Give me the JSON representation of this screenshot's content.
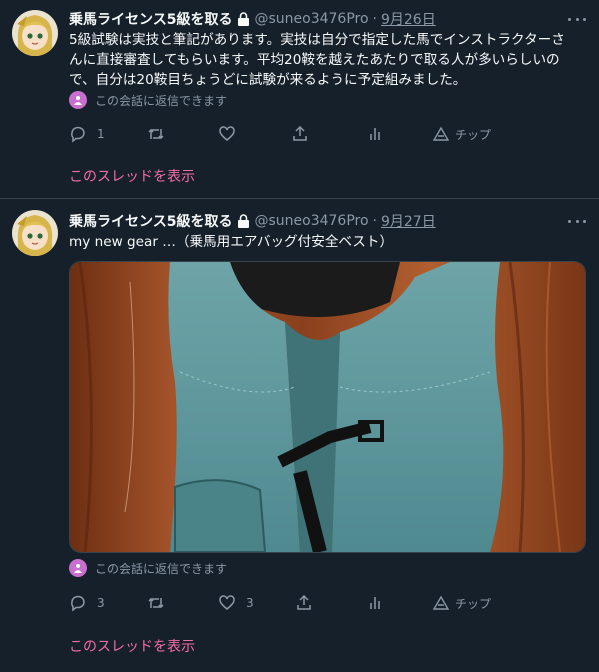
{
  "tweets": [
    {
      "display_name": "乗馬ライセンス5級を取る",
      "handle": "@suneo3476Pro",
      "separator": "·",
      "date": "9月26日",
      "text_lines": [
        "5級試験は実技と筆記があります。実技は自分で指定した馬でインストラクターさ",
        "んに直接審査してもらいます。平均20鞍を越えたあたりで取る人が多いらしいの",
        "で、自分は20鞍目ちょうどに試験が来るように予定組みました。"
      ],
      "reply_note": "この会話に返信できます",
      "actions": {
        "reply_count": "1",
        "retweet_count": "",
        "like_count": "",
        "tip_label": "チップ"
      },
      "thread_link": "このスレッドを表示"
    },
    {
      "display_name": "乗馬ライセンス5級を取る",
      "handle": "@suneo3476Pro",
      "separator": "·",
      "date": "9月27日",
      "text_lines": [
        "my new gear …（乗馬用エアバッグ付安全ベスト）"
      ],
      "reply_note": "この会話に返信できます",
      "actions": {
        "reply_count": "3",
        "retweet_count": "",
        "like_count": "3",
        "tip_label": "チップ"
      },
      "thread_link": "このスレッドを表示"
    }
  ],
  "colors": {
    "background": "#15202b",
    "link": "#f66ca8",
    "muted": "#8b98a5",
    "vest": "#5b9399"
  },
  "icons": [
    "lock-icon",
    "more-icon",
    "reply-icon",
    "retweet-icon",
    "like-icon",
    "share-icon",
    "analytics-icon",
    "tip-icon",
    "conversation-badge-icon"
  ]
}
